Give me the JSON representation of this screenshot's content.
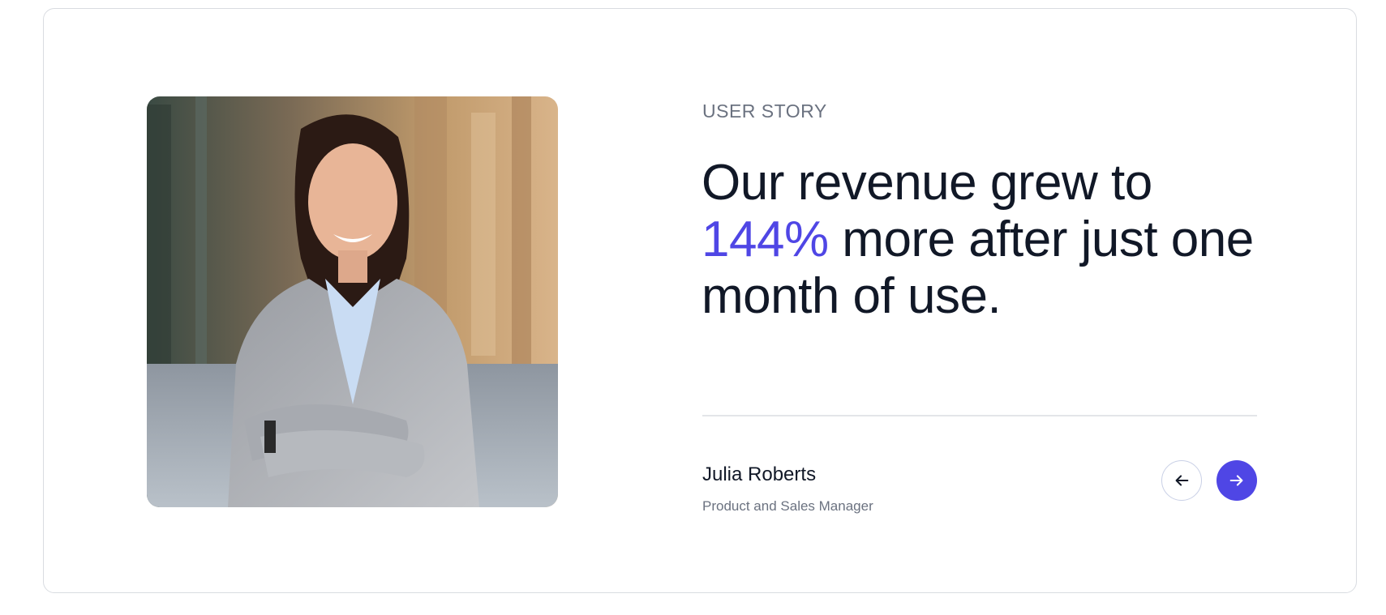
{
  "section": {
    "eyebrow": "USER STORY"
  },
  "quote": {
    "text_before": "Our revenue grew to ",
    "highlight": "144%",
    "text_after": " more after just one month of use.",
    "accent_color": "#4f46e5"
  },
  "author": {
    "name": "Julia Roberts",
    "role": "Product and Sales Manager"
  },
  "navigation": {
    "prev_icon": "arrow-left-icon",
    "next_icon": "arrow-right-icon"
  },
  "photo": {
    "subject": "woman-in-grey-blazer-portrait"
  }
}
